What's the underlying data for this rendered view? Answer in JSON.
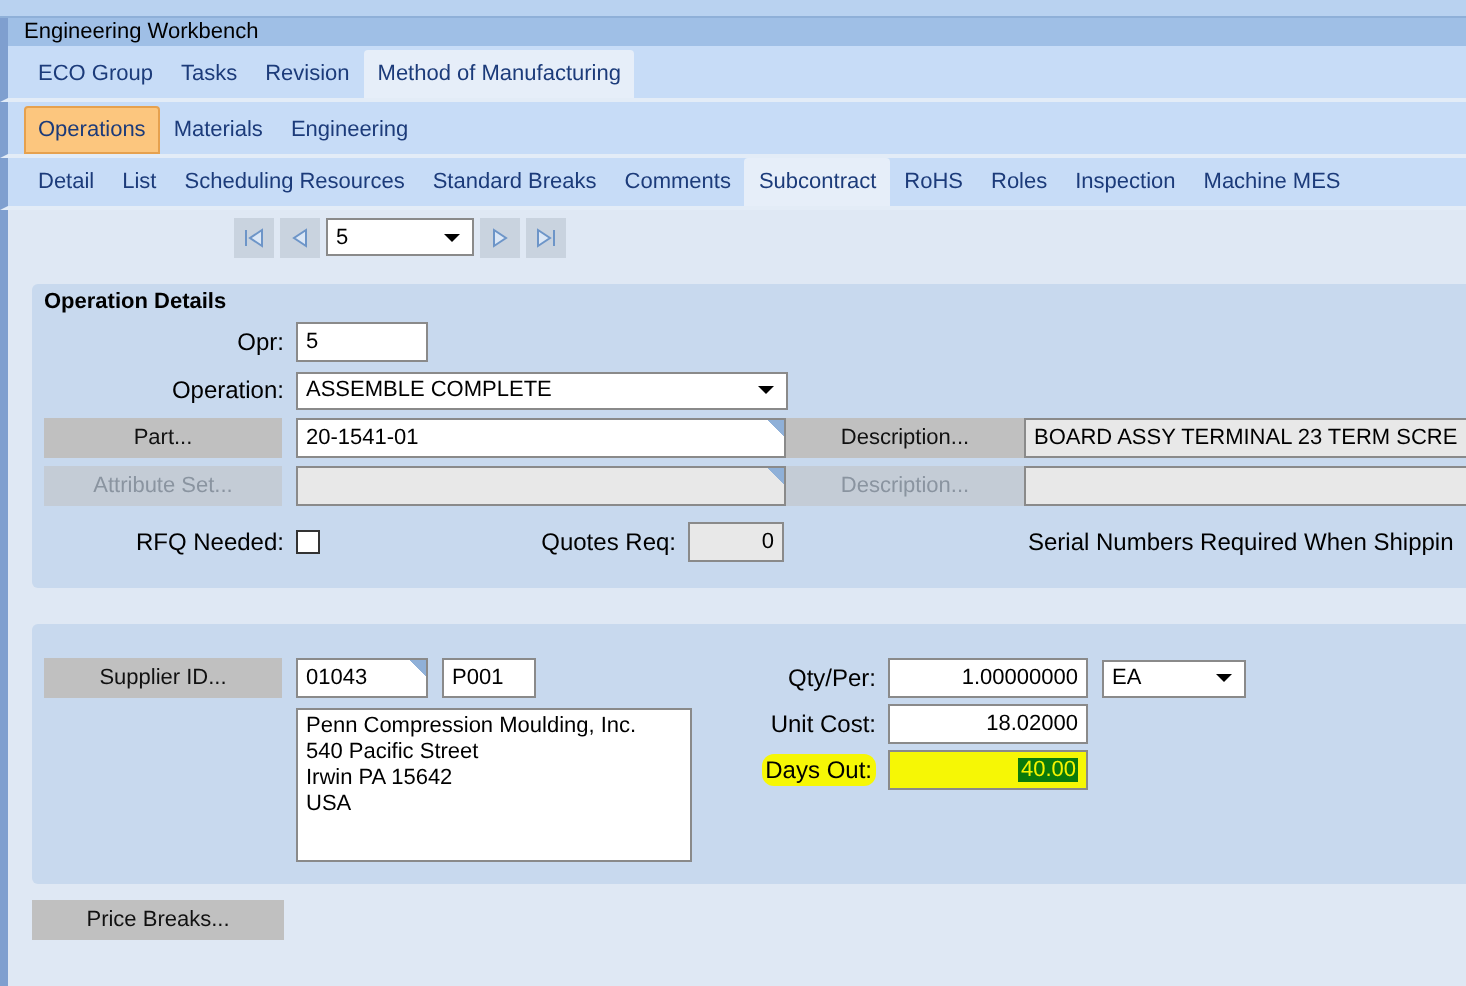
{
  "window": {
    "title": "Engineering Workbench"
  },
  "tabs_main": [
    {
      "label": "ECO Group",
      "selected": false
    },
    {
      "label": "Tasks",
      "selected": false
    },
    {
      "label": "Revision",
      "selected": false
    },
    {
      "label": "Method of Manufacturing",
      "selected": true
    }
  ],
  "tabs_sub": [
    {
      "label": "Operations",
      "selected": true
    },
    {
      "label": "Materials",
      "selected": false
    },
    {
      "label": "Engineering",
      "selected": false
    }
  ],
  "tabs_detail": [
    {
      "label": "Detail",
      "selected": false
    },
    {
      "label": "List",
      "selected": false
    },
    {
      "label": "Scheduling Resources",
      "selected": false
    },
    {
      "label": "Standard Breaks",
      "selected": false
    },
    {
      "label": "Comments",
      "selected": false
    },
    {
      "label": "Subcontract",
      "selected": true
    },
    {
      "label": "RoHS",
      "selected": false
    },
    {
      "label": "Roles",
      "selected": false
    },
    {
      "label": "Inspection",
      "selected": false
    },
    {
      "label": "Machine MES",
      "selected": false
    }
  ],
  "navigator": {
    "value": "5"
  },
  "operation_details": {
    "title": "Operation Details",
    "opr": {
      "label": "Opr:",
      "value": "5"
    },
    "operation": {
      "label": "Operation:",
      "value": "ASSEMBLE COMPLETE"
    },
    "part": {
      "button": "Part...",
      "value": "20-1541-01",
      "disabled": false
    },
    "part_description": {
      "button": "Description...",
      "value": "BOARD ASSY TERMINAL 23 TERM SCRE",
      "disabled": false
    },
    "attribute_set": {
      "button": "Attribute Set...",
      "disabled": true
    },
    "attribute_description": {
      "button": "Description...",
      "disabled": true
    },
    "rfq_needed": {
      "label": "RFQ Needed:",
      "checked": false
    },
    "quotes_req": {
      "label": "Quotes Req:",
      "value": "0"
    },
    "serial_numbers": "Serial Numbers Required When Shippin"
  },
  "supplier": {
    "button": "Supplier ID...",
    "id": "01043",
    "code": "P001",
    "address": [
      "Penn Compression Moulding, Inc.",
      "540 Pacific Street",
      "Irwin PA 15642",
      "USA"
    ],
    "qty_per": {
      "label": "Qty/Per:",
      "value": "1.00000000",
      "uom": "EA"
    },
    "unit_cost": {
      "label": "Unit Cost:",
      "value": "18.02000"
    },
    "days_out": {
      "label": "Days Out:",
      "value": "40.00",
      "highlighted": true
    }
  },
  "price_breaks_button": "Price Breaks..."
}
